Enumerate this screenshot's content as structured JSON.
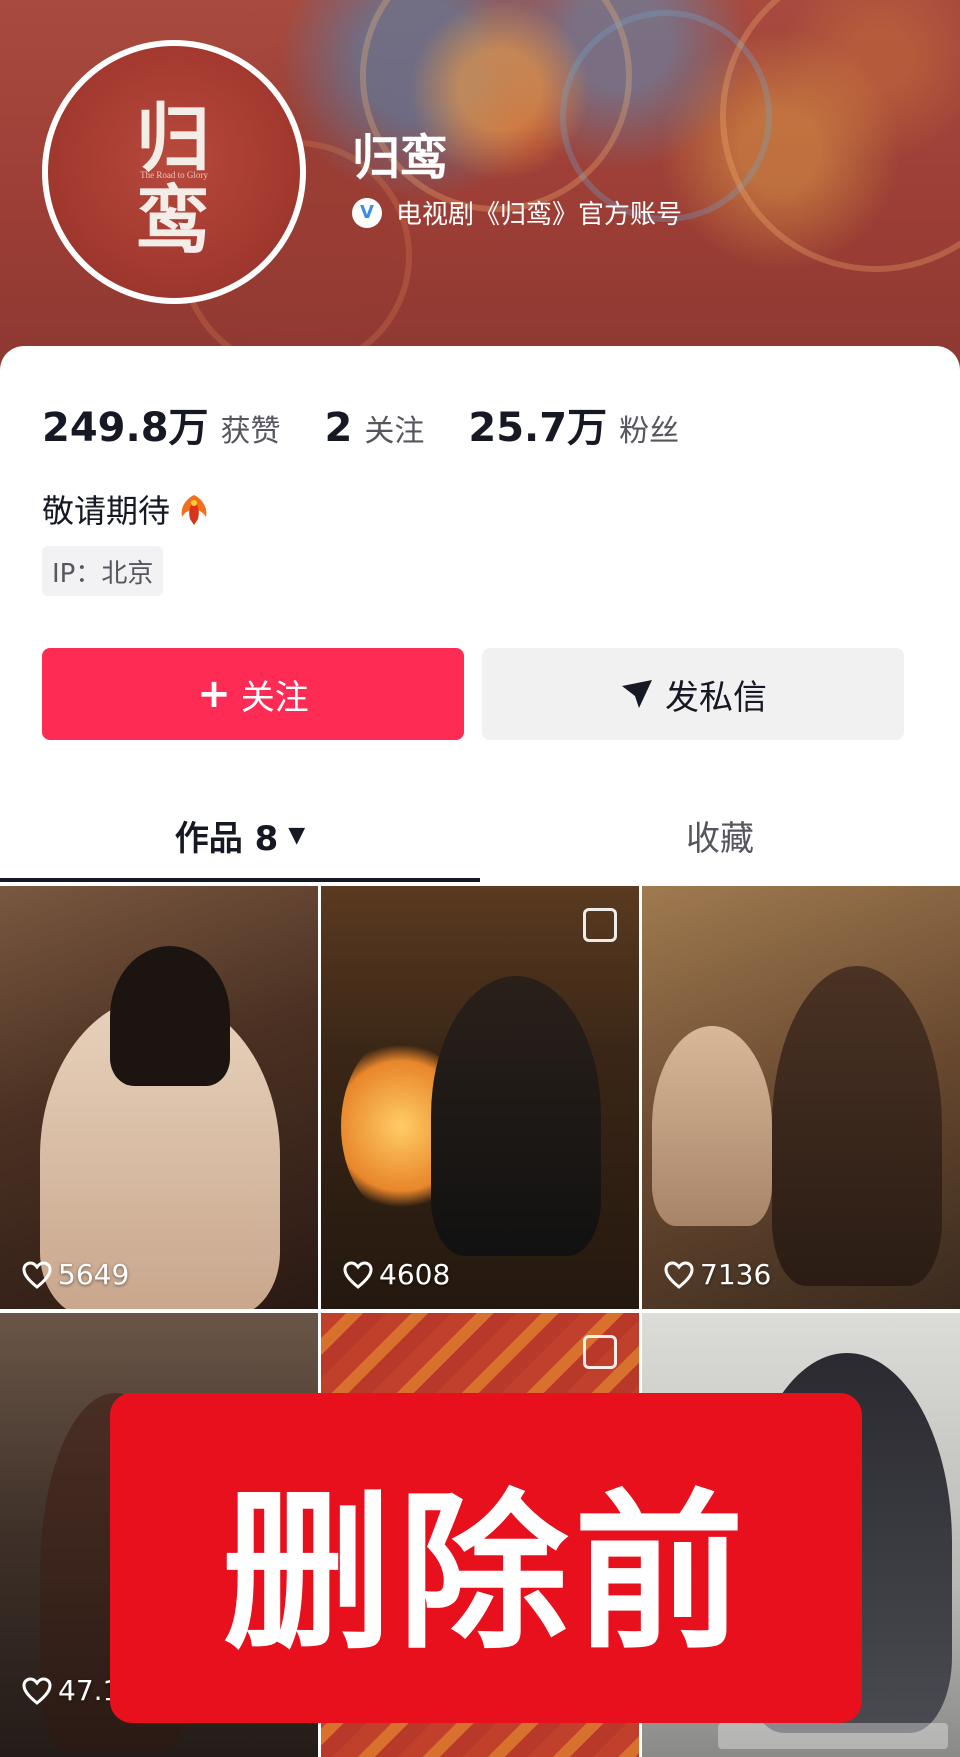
{
  "header": {
    "avatar_title": "归\n鸾",
    "avatar_subtitle": "The Road to Glory",
    "account_name": "归鸾",
    "verified_badge": "V",
    "verified_text": "电视剧《归鸾》官方账号"
  },
  "stats": [
    {
      "num": "249.8万",
      "label": "获赞"
    },
    {
      "num": "2",
      "label": "关注"
    },
    {
      "num": "25.7万",
      "label": "粉丝"
    }
  ],
  "bio": "敬请期待",
  "ip": "IP：北京",
  "buttons": {
    "follow_icon": "+",
    "follow": "关注",
    "message": "发私信"
  },
  "tabs": {
    "works": "作品 8",
    "works_caret": "▼",
    "favorites": "收藏"
  },
  "videos": [
    {
      "likes": "5649"
    },
    {
      "likes": "4608"
    },
    {
      "likes": "7136"
    },
    {
      "likes": "47.1"
    },
    {
      "likes": ""
    },
    {
      "likes": ""
    }
  ],
  "overlay_text": "删除前",
  "icons": [
    "verified-icon",
    "phoenix-emoji-icon",
    "plus-icon",
    "send-icon",
    "caret-down-icon",
    "heart-icon",
    "pin-icon"
  ]
}
